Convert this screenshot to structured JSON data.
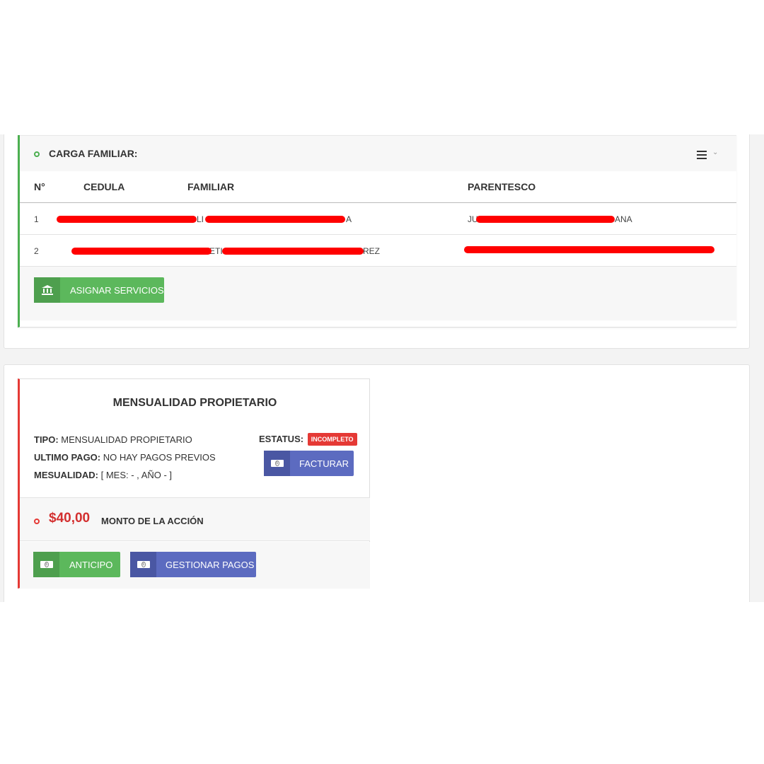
{
  "family": {
    "title": "CARGA FAMILIAR:",
    "menu_icon": "hamburger-icon",
    "columns": [
      "N°",
      "CEDULA",
      "FAMILIAR",
      "PARENTESCO"
    ],
    "rows": [
      {
        "n": "1",
        "cedula": "",
        "familiar_start": "LI",
        "familiar_end": "A",
        "parentesco_start": "JU",
        "parentesco_end": "ANA"
      },
      {
        "n": "2",
        "cedula": "",
        "familiar_start": "ETI",
        "familiar_end": "REZ",
        "parentesco_start": "",
        "parentesco_end": ""
      }
    ],
    "assign_button": "ASIGNAR SERVICIOS",
    "accent_color": "#4caf50"
  },
  "monthly": {
    "title": "MENSUALIDAD PROPIETARIO",
    "tipo_label": "TIPO:",
    "tipo_value": "MENSUALIDAD PROPIETARIO",
    "ultimo_pago_label": "ULTIMO PAGO:",
    "ultimo_pago_value": "NO HAY PAGOS PREVIOS",
    "mensualidad_label": "MESUALIDAD:",
    "mensualidad_value": "[ MES: - , AÑO - ]",
    "status_label": "ESTATUS:",
    "status_badge": "INCOMPLETO",
    "facturar_button": "FACTURAR",
    "amount": "$40,00",
    "amount_label": "MONTO DE LA ACCIÓN",
    "anticipo_button": "ANTICIPO",
    "gestionar_button": "GESTIONAR PAGOS",
    "accent_color": "#e53935"
  }
}
